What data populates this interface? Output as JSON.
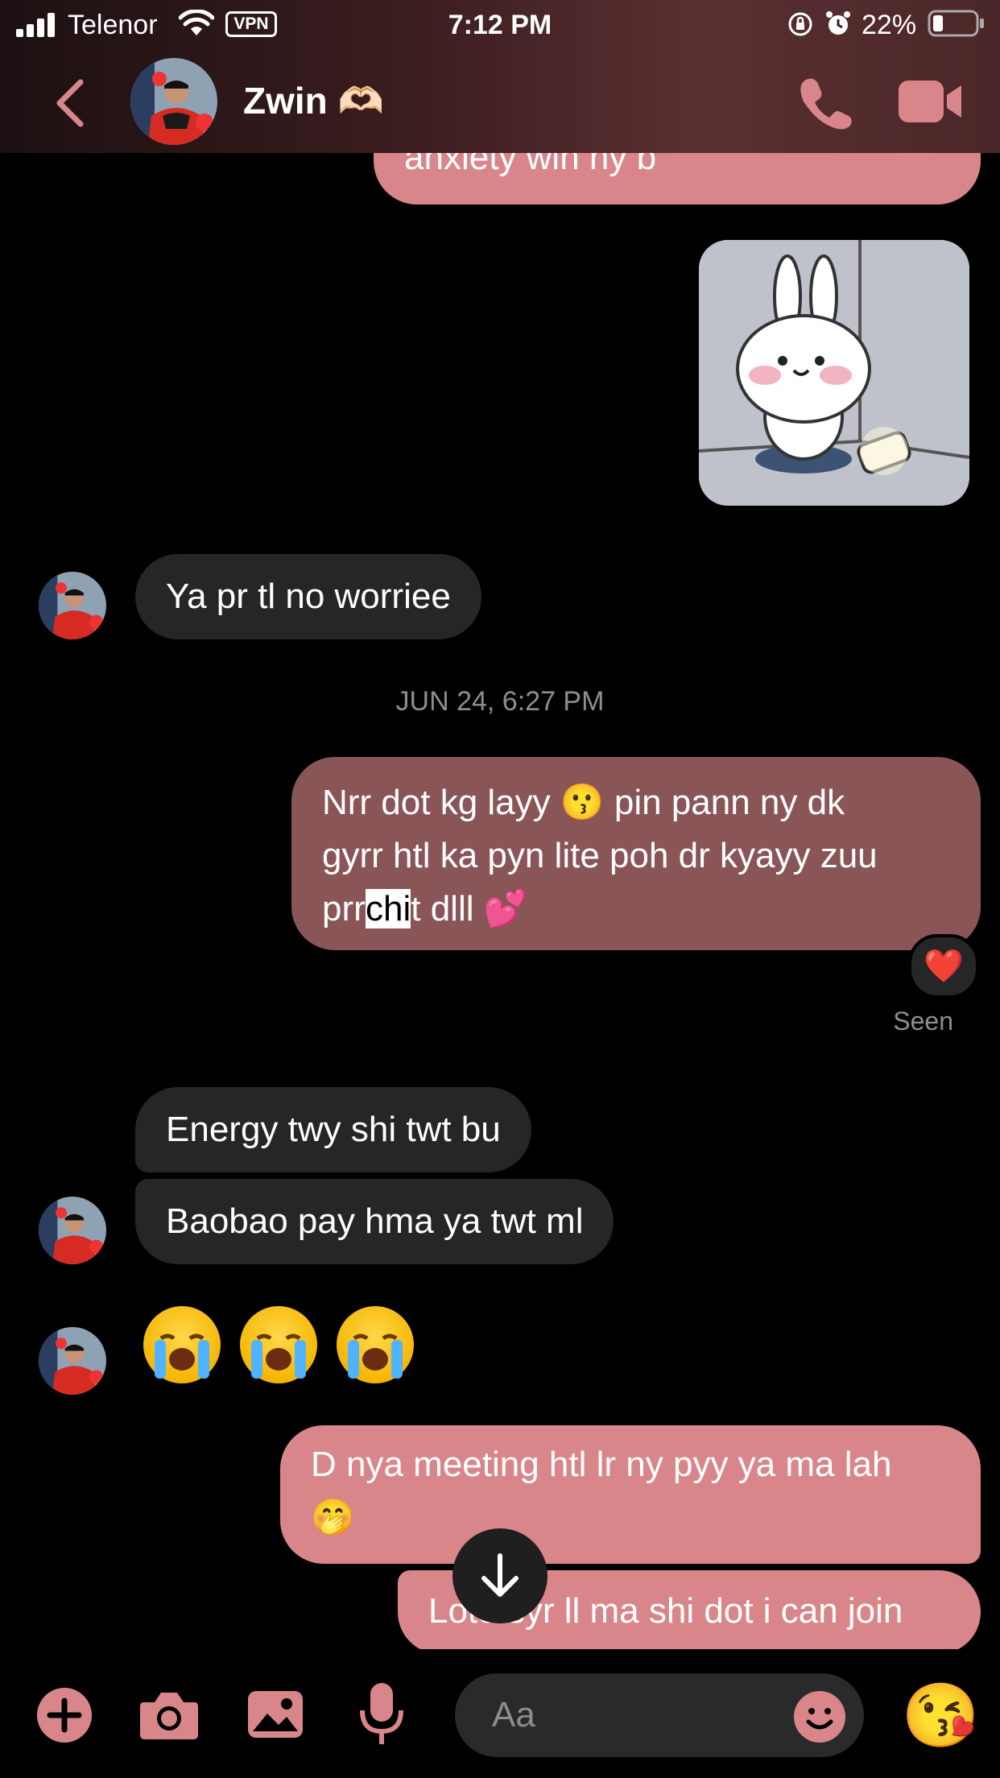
{
  "status_bar": {
    "carrier": "Telenor",
    "vpn": "VPN",
    "time": "7:12 PM",
    "battery": "22%"
  },
  "header": {
    "contact_name": "Zwin 🫶🏻",
    "back_icon": "chevron-left-icon",
    "call_icon": "phone-icon",
    "video_icon": "video-camera-icon"
  },
  "messages": {
    "m1": "anxiety win ny b",
    "m2": "Ya pr tl no worriee",
    "timestamp": "JUN 24, 6:27 PM",
    "m3_line1": "Nrr dot kg layy 😗 pin pann ny dk",
    "m3_line2": "gyrr htl ka pyn lite poh dr kyayy zuu",
    "m3_line3_a": "prr ",
    "m3_line3_sel": "chi",
    "m3_line3_b": "t dlll 💕",
    "reaction": "❤️",
    "seen": "Seen",
    "m4": "Energy twy shi twt bu",
    "m5": "Baobao pay hma ya twt ml",
    "m7_line1": "D nya meeting htl lr ny pyy ya ma lah",
    "m7_line2": "🤭",
    "m8": "Loto syr ll ma shi dot i can join"
  },
  "composer": {
    "placeholder": "Aa",
    "quick_reaction": "😘"
  },
  "colors": {
    "accent": "#d9868a",
    "outgoing_dark": "#8a5556",
    "incoming": "#262626"
  }
}
